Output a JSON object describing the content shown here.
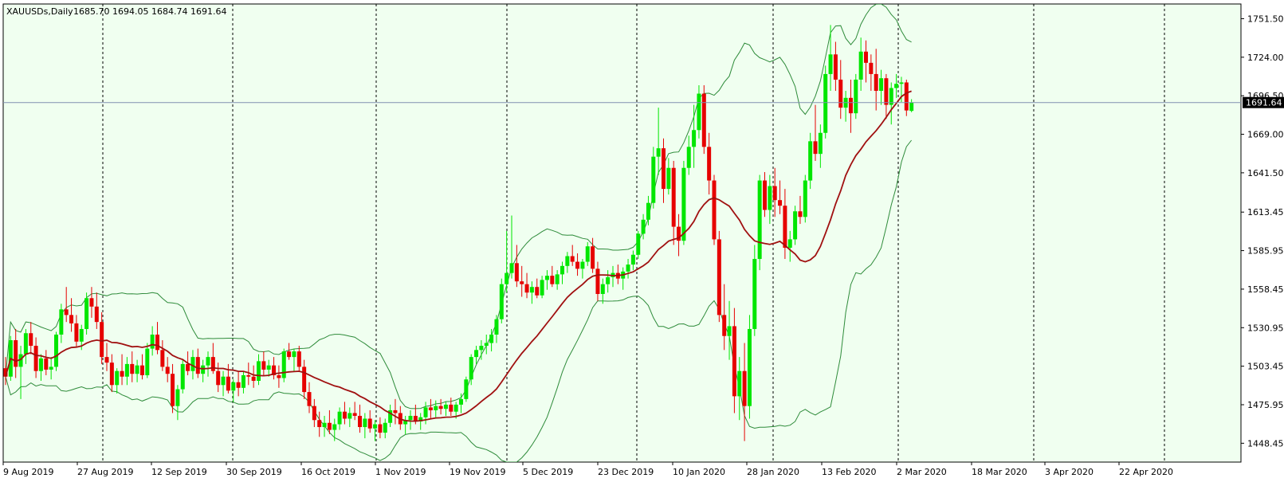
{
  "header": {
    "symbol": "XAUUSDs,Daily",
    "ohlc": "1685.70 1694.05 1684.74 1691.64"
  },
  "colors": {
    "background": "#f0fff0",
    "bull": "#00e600",
    "bear": "#e60000",
    "ma": "#a01010",
    "band": "#2e8b3a",
    "price_line": "#8090b0",
    "grid": "#000000"
  },
  "chart_data": {
    "type": "candlestick",
    "title": "XAUUSDs,Daily",
    "ylim": [
      1435,
      1762
    ],
    "y_ticks": [
      1751.5,
      1724.0,
      1696.5,
      1669.0,
      1641.5,
      1613.45,
      1585.95,
      1558.45,
      1530.95,
      1503.45,
      1475.95,
      1448.45
    ],
    "x_labels": [
      "9 Aug 2019",
      "27 Aug 2019",
      "12 Sep 2019",
      "30 Sep 2019",
      "16 Oct 2019",
      "1 Nov 2019",
      "19 Nov 2019",
      "5 Dec 2019",
      "23 Dec 2019",
      "10 Jan 2020",
      "28 Jan 2020",
      "13 Feb 2020",
      "2 Mar 2020",
      "18 Mar 2020",
      "3 Apr 2020",
      "22 Apr 2020"
    ],
    "current_price": 1691.64,
    "current_price_label": "1691.64",
    "period_separators": [
      19,
      42,
      64,
      87,
      107,
      130,
      152,
      174,
      196
    ],
    "candles": [
      [
        1502,
        1510,
        1490,
        1496
      ],
      [
        1496,
        1525,
        1493,
        1522
      ],
      [
        1522,
        1530,
        1495,
        1503
      ],
      [
        1503,
        1518,
        1480,
        1512
      ],
      [
        1512,
        1530,
        1505,
        1527
      ],
      [
        1527,
        1535,
        1512,
        1518
      ],
      [
        1518,
        1524,
        1495,
        1500
      ],
      [
        1500,
        1512,
        1493,
        1509
      ],
      [
        1509,
        1515,
        1497,
        1501
      ],
      [
        1501,
        1510,
        1494,
        1503
      ],
      [
        1503,
        1528,
        1500,
        1526
      ],
      [
        1526,
        1548,
        1520,
        1544
      ],
      [
        1544,
        1560,
        1535,
        1540
      ],
      [
        1540,
        1552,
        1528,
        1534
      ],
      [
        1534,
        1540,
        1517,
        1521
      ],
      [
        1521,
        1533,
        1515,
        1530
      ],
      [
        1530,
        1556,
        1526,
        1552
      ],
      [
        1552,
        1560,
        1538,
        1546
      ],
      [
        1546,
        1556,
        1530,
        1535
      ],
      [
        1535,
        1542,
        1505,
        1510
      ],
      [
        1510,
        1520,
        1500,
        1506
      ],
      [
        1506,
        1512,
        1485,
        1490
      ],
      [
        1490,
        1502,
        1484,
        1500
      ],
      [
        1500,
        1512,
        1490,
        1496
      ],
      [
        1496,
        1510,
        1490,
        1505
      ],
      [
        1505,
        1514,
        1492,
        1498
      ],
      [
        1498,
        1508,
        1492,
        1504
      ],
      [
        1504,
        1512,
        1494,
        1497
      ],
      [
        1497,
        1520,
        1495,
        1516
      ],
      [
        1516,
        1532,
        1511,
        1526
      ],
      [
        1526,
        1535,
        1512,
        1515
      ],
      [
        1515,
        1522,
        1500,
        1503
      ],
      [
        1503,
        1510,
        1492,
        1498
      ],
      [
        1498,
        1505,
        1470,
        1475
      ],
      [
        1475,
        1490,
        1465,
        1487
      ],
      [
        1487,
        1508,
        1484,
        1505
      ],
      [
        1505,
        1514,
        1497,
        1500
      ],
      [
        1500,
        1515,
        1494,
        1510
      ],
      [
        1510,
        1516,
        1495,
        1498
      ],
      [
        1498,
        1508,
        1492,
        1504
      ],
      [
        1504,
        1514,
        1496,
        1510
      ],
      [
        1510,
        1520,
        1498,
        1500
      ],
      [
        1500,
        1506,
        1485,
        1490
      ],
      [
        1490,
        1500,
        1482,
        1496
      ],
      [
        1496,
        1505,
        1484,
        1486
      ],
      [
        1486,
        1494,
        1478,
        1492
      ],
      [
        1492,
        1500,
        1482,
        1488
      ],
      [
        1488,
        1500,
        1484,
        1497
      ],
      [
        1497,
        1506,
        1490,
        1496
      ],
      [
        1496,
        1504,
        1488,
        1493
      ],
      [
        1493,
        1512,
        1490,
        1507
      ],
      [
        1507,
        1514,
        1497,
        1501
      ],
      [
        1501,
        1508,
        1496,
        1504
      ],
      [
        1504,
        1510,
        1494,
        1497
      ],
      [
        1497,
        1504,
        1488,
        1495
      ],
      [
        1495,
        1516,
        1492,
        1514
      ],
      [
        1514,
        1520,
        1508,
        1510
      ],
      [
        1510,
        1516,
        1500,
        1514
      ],
      [
        1514,
        1518,
        1500,
        1503
      ],
      [
        1503,
        1508,
        1480,
        1485
      ],
      [
        1485,
        1492,
        1470,
        1475
      ],
      [
        1475,
        1480,
        1460,
        1465
      ],
      [
        1465,
        1471,
        1453,
        1460
      ],
      [
        1460,
        1468,
        1453,
        1463
      ],
      [
        1463,
        1472,
        1455,
        1458
      ],
      [
        1458,
        1466,
        1450,
        1462
      ],
      [
        1462,
        1474,
        1458,
        1471
      ],
      [
        1471,
        1478,
        1462,
        1466
      ],
      [
        1466,
        1474,
        1460,
        1470
      ],
      [
        1470,
        1478,
        1465,
        1468
      ],
      [
        1468,
        1476,
        1456,
        1460
      ],
      [
        1460,
        1470,
        1452,
        1466
      ],
      [
        1466,
        1472,
        1456,
        1459
      ],
      [
        1459,
        1465,
        1450,
        1462
      ],
      [
        1462,
        1467,
        1452,
        1456
      ],
      [
        1456,
        1466,
        1452,
        1463
      ],
      [
        1463,
        1476,
        1460,
        1472
      ],
      [
        1472,
        1480,
        1462,
        1470
      ],
      [
        1470,
        1475,
        1458,
        1462
      ],
      [
        1462,
        1468,
        1455,
        1465
      ],
      [
        1465,
        1472,
        1458,
        1468
      ],
      [
        1468,
        1476,
        1462,
        1464
      ],
      [
        1464,
        1470,
        1458,
        1467
      ],
      [
        1467,
        1478,
        1462,
        1474
      ],
      [
        1474,
        1480,
        1466,
        1472
      ],
      [
        1472,
        1479,
        1467,
        1475
      ],
      [
        1475,
        1480,
        1469,
        1473
      ],
      [
        1473,
        1478,
        1468,
        1476
      ],
      [
        1476,
        1481,
        1468,
        1471
      ],
      [
        1471,
        1478,
        1466,
        1476
      ],
      [
        1476,
        1484,
        1470,
        1480
      ],
      [
        1480,
        1496,
        1478,
        1494
      ],
      [
        1494,
        1512,
        1490,
        1510
      ],
      [
        1510,
        1518,
        1505,
        1515
      ],
      [
        1515,
        1522,
        1508,
        1518
      ],
      [
        1518,
        1526,
        1512,
        1520
      ],
      [
        1520,
        1530,
        1514,
        1526
      ],
      [
        1526,
        1540,
        1520,
        1537
      ],
      [
        1537,
        1566,
        1534,
        1562
      ],
      [
        1562,
        1600,
        1556,
        1570
      ],
      [
        1570,
        1611,
        1566,
        1577
      ],
      [
        1577,
        1590,
        1560,
        1564
      ],
      [
        1564,
        1575,
        1553,
        1562
      ],
      [
        1562,
        1570,
        1552,
        1556
      ],
      [
        1556,
        1564,
        1548,
        1560
      ],
      [
        1560,
        1566,
        1552,
        1554
      ],
      [
        1554,
        1568,
        1552,
        1565
      ],
      [
        1565,
        1572,
        1558,
        1568
      ],
      [
        1568,
        1575,
        1560,
        1562
      ],
      [
        1562,
        1572,
        1558,
        1569
      ],
      [
        1569,
        1578,
        1562,
        1575
      ],
      [
        1575,
        1585,
        1570,
        1582
      ],
      [
        1582,
        1590,
        1575,
        1578
      ],
      [
        1578,
        1584,
        1568,
        1573
      ],
      [
        1573,
        1580,
        1566,
        1578
      ],
      [
        1578,
        1592,
        1575,
        1589
      ],
      [
        1589,
        1595,
        1570,
        1573
      ],
      [
        1573,
        1578,
        1550,
        1555
      ],
      [
        1555,
        1566,
        1548,
        1562
      ],
      [
        1562,
        1572,
        1556,
        1567
      ],
      [
        1567,
        1575,
        1560,
        1570
      ],
      [
        1570,
        1576,
        1562,
        1566
      ],
      [
        1566,
        1574,
        1558,
        1571
      ],
      [
        1571,
        1580,
        1566,
        1576
      ],
      [
        1576,
        1586,
        1572,
        1583
      ],
      [
        1583,
        1600,
        1580,
        1598
      ],
      [
        1598,
        1612,
        1594,
        1608
      ],
      [
        1608,
        1625,
        1604,
        1620
      ],
      [
        1620,
        1660,
        1616,
        1653
      ],
      [
        1653,
        1688,
        1640,
        1659
      ],
      [
        1659,
        1666,
        1620,
        1630
      ],
      [
        1630,
        1652,
        1626,
        1645
      ],
      [
        1645,
        1650,
        1590,
        1603
      ],
      [
        1603,
        1612,
        1582,
        1593
      ],
      [
        1593,
        1650,
        1590,
        1645
      ],
      [
        1645,
        1668,
        1640,
        1660
      ],
      [
        1660,
        1690,
        1645,
        1672
      ],
      [
        1672,
        1704,
        1666,
        1698
      ],
      [
        1698,
        1704,
        1655,
        1660
      ],
      [
        1660,
        1670,
        1626,
        1636
      ],
      [
        1636,
        1640,
        1590,
        1594
      ],
      [
        1594,
        1600,
        1535,
        1540
      ],
      [
        1540,
        1562,
        1515,
        1525
      ],
      [
        1525,
        1550,
        1508,
        1532
      ],
      [
        1532,
        1545,
        1470,
        1482
      ],
      [
        1482,
        1510,
        1465,
        1500
      ],
      [
        1500,
        1520,
        1450,
        1475
      ],
      [
        1475,
        1540,
        1466,
        1530
      ],
      [
        1530,
        1590,
        1525,
        1580
      ],
      [
        1580,
        1640,
        1572,
        1636
      ],
      [
        1636,
        1642,
        1610,
        1615
      ],
      [
        1615,
        1640,
        1605,
        1632
      ],
      [
        1632,
        1645,
        1610,
        1622
      ],
      [
        1622,
        1636,
        1612,
        1618
      ],
      [
        1618,
        1630,
        1580,
        1588
      ],
      [
        1588,
        1600,
        1578,
        1594
      ],
      [
        1594,
        1618,
        1590,
        1614
      ],
      [
        1614,
        1625,
        1605,
        1610
      ],
      [
        1610,
        1640,
        1606,
        1636
      ],
      [
        1636,
        1670,
        1630,
        1664
      ],
      [
        1664,
        1690,
        1650,
        1655
      ],
      [
        1655,
        1676,
        1645,
        1670
      ],
      [
        1670,
        1718,
        1666,
        1712
      ],
      [
        1712,
        1747,
        1700,
        1726
      ],
      [
        1726,
        1735,
        1700,
        1708
      ],
      [
        1708,
        1722,
        1680,
        1688
      ],
      [
        1688,
        1700,
        1678,
        1695
      ],
      [
        1695,
        1708,
        1670,
        1684
      ],
      [
        1684,
        1712,
        1680,
        1708
      ],
      [
        1708,
        1738,
        1700,
        1728
      ],
      [
        1728,
        1736,
        1706,
        1720
      ],
      [
        1720,
        1726,
        1700,
        1712
      ],
      [
        1712,
        1730,
        1686,
        1700
      ],
      [
        1700,
        1715,
        1690,
        1709
      ],
      [
        1709,
        1712,
        1680,
        1690
      ],
      [
        1690,
        1706,
        1676,
        1702
      ],
      [
        1702,
        1712,
        1695,
        1705
      ],
      [
        1705,
        1710,
        1692,
        1706
      ],
      [
        1706,
        1708,
        1682,
        1686
      ],
      [
        1685.7,
        1694.05,
        1684.74,
        1691.64
      ]
    ]
  },
  "period_sep_extra": [
    216,
    238,
    160
  ]
}
